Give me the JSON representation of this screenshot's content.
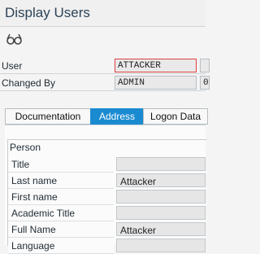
{
  "window": {
    "title": "Display Users"
  },
  "toolbar": {
    "icon": "glasses-icon"
  },
  "header_fields": [
    {
      "label": "User",
      "value": "ATTACKER",
      "extra": ""
    },
    {
      "label": "Changed By",
      "value": "ADMIN",
      "extra": "0"
    }
  ],
  "tabs": [
    {
      "label": "Documentation",
      "active": false
    },
    {
      "label": "Address",
      "active": true
    },
    {
      "label": "Logon Data",
      "active": false
    }
  ],
  "person": {
    "title": "Person",
    "fields": [
      {
        "label": "Title",
        "value": ""
      },
      {
        "label": "Last name",
        "value": "Attacker"
      },
      {
        "label": "First name",
        "value": ""
      },
      {
        "label": "Academic Title",
        "value": ""
      },
      {
        "label": "Full Name",
        "value": "Attacker"
      },
      {
        "label": "Language",
        "value": ""
      }
    ]
  },
  "colors": {
    "active_tab": "#1a8bd0",
    "required_marker": "#e04040"
  }
}
